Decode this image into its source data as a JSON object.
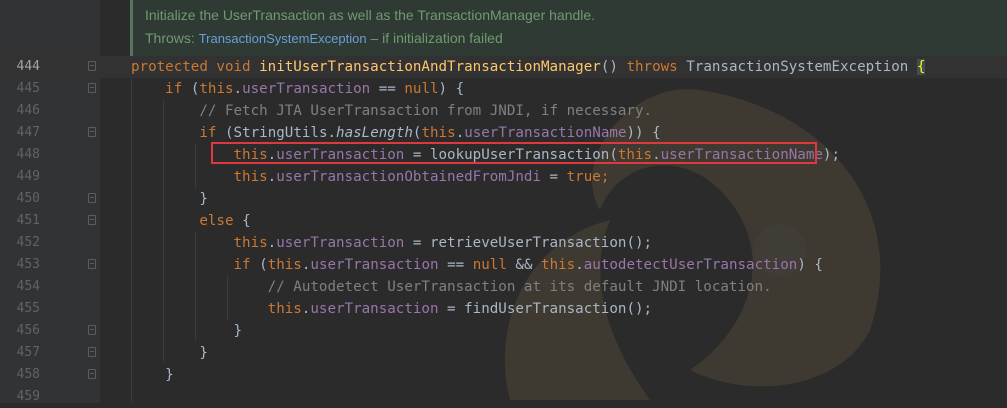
{
  "doc": {
    "line1": "Initialize the UserTransaction as well as the TransactionManager handle.",
    "throws_label": "Throws:",
    "throws_exception": "TransactionSystemException",
    "throws_desc": " – if initialization failed"
  },
  "lines": [
    {
      "n": "444",
      "current": true
    },
    {
      "n": "445"
    },
    {
      "n": "446"
    },
    {
      "n": "447"
    },
    {
      "n": "448"
    },
    {
      "n": "449"
    },
    {
      "n": "450"
    },
    {
      "n": "451"
    },
    {
      "n": "452"
    },
    {
      "n": "453"
    },
    {
      "n": "454"
    },
    {
      "n": "455"
    },
    {
      "n": "456"
    },
    {
      "n": "457"
    },
    {
      "n": "458"
    },
    {
      "n": "459"
    }
  ],
  "tokens": {
    "kw_protected": "protected",
    "kw_void": "void",
    "method_decl": "initUserTransactionAndTransactionManager",
    "paren_pair": "()",
    "kw_throws": "throws",
    "exc_type": "TransactionSystemException",
    "brace_open": "{",
    "brace_close": "}",
    "kw_if": "if",
    "kw_this": "this",
    "kw_null": "null",
    "kw_true": "true",
    "kw_else": "else",
    "f_userTransaction": "userTransaction",
    "f_userTransactionName": "userTransactionName",
    "f_obtained": "userTransactionObtainedFromJndi",
    "f_autodetect": "autodetectUserTransaction",
    "comment_446": "// Fetch JTA UserTransaction from JNDI, if necessary.",
    "comment_454": "// Autodetect UserTransaction at its default JNDI location.",
    "stringutils": "StringUtils",
    "haslength": "hasLength",
    "lookup": "lookupUserTransaction",
    "retrieve": "retrieveUserTransaction",
    "find": "findUserTransaction",
    "eq_null": " == ",
    "and": " && ",
    "assign": " = ",
    "dot": ".",
    "semi": ";",
    "lparen": "(",
    "rparen": ")",
    "close_if": ") {",
    "close_paren_semi": ");",
    "empty_call_semi": "();"
  },
  "colors": {
    "keyword": "#cc7832",
    "field": "#9876aa",
    "method_decl": "#ffc66d",
    "comment": "#808080",
    "highlight_box": "#e0383e"
  }
}
